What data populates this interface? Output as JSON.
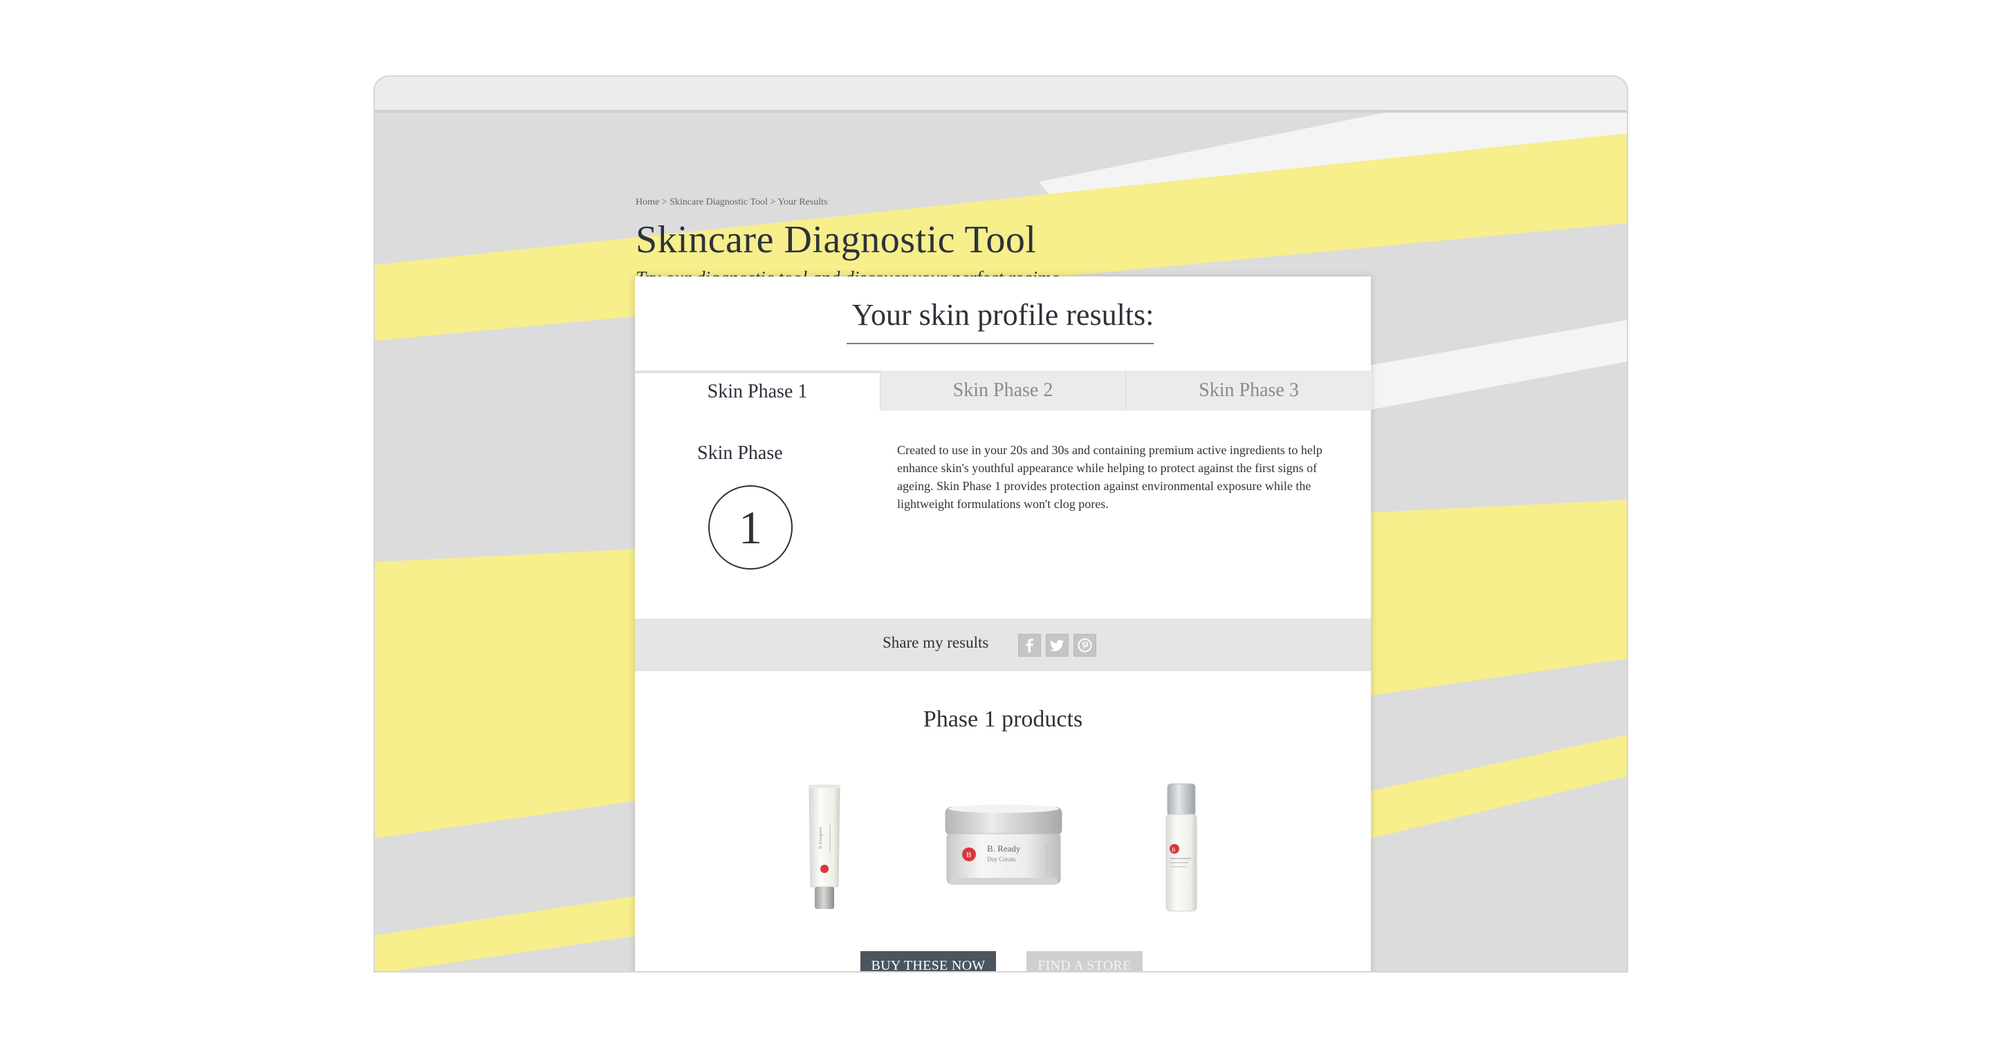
{
  "breadcrumb": "Home > Skincare Diagnostic Tool > Your Results",
  "page": {
    "title": "Skincare Diagnostic Tool",
    "subtitle": "Try our diagnostic tool and discover your perfect regime."
  },
  "results": {
    "heading": "Your skin profile results:",
    "tabs": [
      {
        "label": "Skin Phase 1",
        "active": true
      },
      {
        "label": "Skin Phase 2",
        "active": false
      },
      {
        "label": "Skin Phase 3",
        "active": false
      }
    ],
    "phase_label": "Skin Phase",
    "phase_number": "1",
    "description": "Created to use in your 20s and 30s and containing premium active ingredients to help enhance skin's youthful appearance while helping to protect against the first signs of ageing. Skin Phase 1 provides protection against environmental exposure while the lightweight formulations won't clog pores."
  },
  "share": {
    "label": "Share my results",
    "icons": [
      "facebook-icon",
      "twitter-icon",
      "pinterest-icon"
    ]
  },
  "products": {
    "title": "Phase 1 products",
    "items": [
      {
        "icon": "tube-product-image",
        "brand_mark": "B."
      },
      {
        "icon": "jar-product-image",
        "brand_mark": "B.",
        "name": "B. Ready",
        "subname": "Day Cream"
      },
      {
        "icon": "pump-bottle-product-image",
        "brand_mark": "B."
      }
    ]
  },
  "buttons": {
    "buy": "BUY THESE NOW",
    "store": "FIND A STORE"
  },
  "colors": {
    "accent_yellow": "#f7ee8c",
    "background_grey": "#dcdcdd",
    "button_dark": "#4a5560",
    "button_light": "#cfcfcf",
    "title_text": "#2d323a"
  }
}
